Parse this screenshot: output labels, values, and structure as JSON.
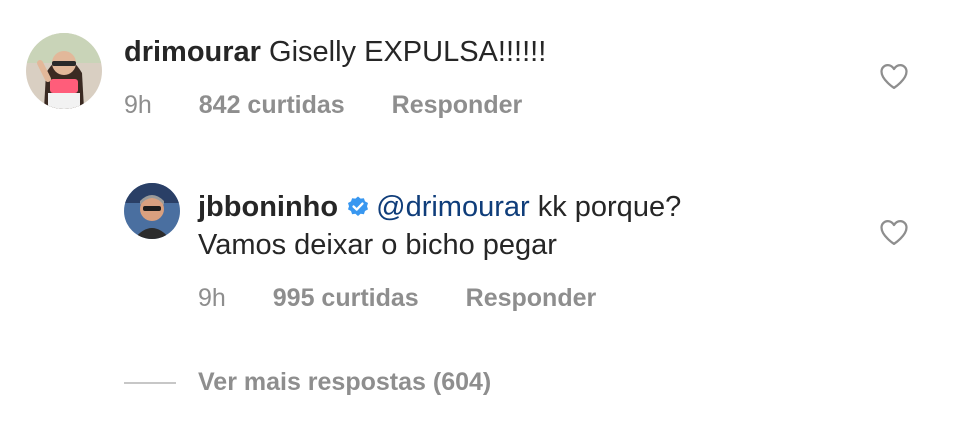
{
  "comments": [
    {
      "username": "drimourar",
      "text": "Giselly EXPULSA!!!!!!",
      "time": "9h",
      "likes": "842 curtidas",
      "reply_label": "Responder",
      "avatar_icon": "user-photo-avatar"
    },
    {
      "username": "jbboninho",
      "verified": true,
      "mention": "@drimourar",
      "text_line1": " kk porque?",
      "text_line2": "Vamos deixar o bicho pegar",
      "time": "9h",
      "likes": "995 curtidas",
      "reply_label": "Responder",
      "avatar_icon": "user-photo-avatar"
    }
  ],
  "view_more_label": "Ver mais respostas (604)",
  "colors": {
    "text": "#262626",
    "meta": "#8e8e8e",
    "mention": "#0f3d7a",
    "verified": "#3897f0",
    "divider": "#c7c7c7"
  },
  "icons": {
    "like": "heart-outline-icon",
    "verified": "verified-badge-icon"
  }
}
